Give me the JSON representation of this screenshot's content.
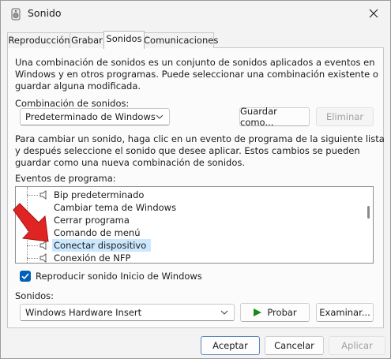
{
  "window": {
    "title": "Sonido"
  },
  "tabs": [
    {
      "label": "Reproducción"
    },
    {
      "label": "Grabar"
    },
    {
      "label": "Sonidos"
    },
    {
      "label": "Comunicaciones"
    }
  ],
  "active_tab": "Sonidos",
  "intro_text": {
    "line1": "Una combinación de sonidos es un conjunto de sonidos aplicados a eventos en",
    "line2": "Windows y en otros programas. Puede seleccionar una combinación existente o",
    "line3": "guardar alguna modificada."
  },
  "scheme": {
    "label": "Combinación de sonidos:",
    "value": "Predeterminado de Windows",
    "save_button": "Guardar como...",
    "delete_button": "Eliminar"
  },
  "change_text": {
    "line1": "Para cambiar un sonido, haga clic en un evento de programa de la siguiente lista",
    "line2": "y después seleccione el sonido que desee aplicar. Estos cambios se pueden",
    "line3": "guardar como una nueva combinación de sonidos."
  },
  "events": {
    "label": "Eventos de programa:",
    "items": [
      {
        "label": "Bip predeterminado",
        "has_sound": true
      },
      {
        "label": "Cambiar tema de Windows",
        "has_sound": false
      },
      {
        "label": "Cerrar programa",
        "has_sound": false
      },
      {
        "label": "Comando de menú",
        "has_sound": false
      },
      {
        "label": "Conectar dispositivo",
        "has_sound": true,
        "selected": true
      },
      {
        "label": "Conexión de NFP",
        "has_sound": true
      }
    ]
  },
  "startup_checkbox": {
    "label": "Reproducir sonido Inicio de Windows",
    "checked": true
  },
  "sounds": {
    "label": "Sonidos:",
    "value": "Windows Hardware Insert",
    "test_button": "Probar",
    "browse_button": "Examinar..."
  },
  "footer": {
    "accept": "Aceptar",
    "cancel": "Cancelar",
    "apply": "Aplicar"
  },
  "colors": {
    "accent": "#005fb8",
    "selection": "#cce8ff",
    "annotation_arrow": "#e02424",
    "play_icon": "#1a8a1a"
  }
}
